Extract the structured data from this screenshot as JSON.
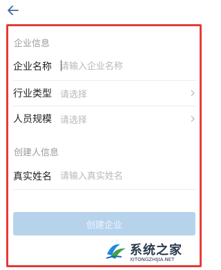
{
  "header": {
    "back_icon": "arrow-left-icon"
  },
  "sections": {
    "company_info": "企业信息",
    "creator_info": "创建人信息"
  },
  "fields": {
    "company_name": {
      "label": "企业名称",
      "placeholder": "请输入企业名称"
    },
    "industry": {
      "label": "行业类型",
      "value": "请选择",
      "icon": "chevron-right-icon"
    },
    "staff_size": {
      "label": "人员规模",
      "value": "请选择",
      "icon": "chevron-right-icon"
    },
    "real_name": {
      "label": "真实姓名",
      "placeholder": "请输入真实姓名"
    }
  },
  "actions": {
    "create_label": "创建企业"
  },
  "watermark": {
    "title": "系统之家",
    "url": "XITONGZHIJIA.NET"
  },
  "colors": {
    "highlight": "#e53935",
    "button_disabled": "#b7d3ec",
    "text_muted": "#9a9a9a",
    "placeholder": "#b8b8b8"
  }
}
